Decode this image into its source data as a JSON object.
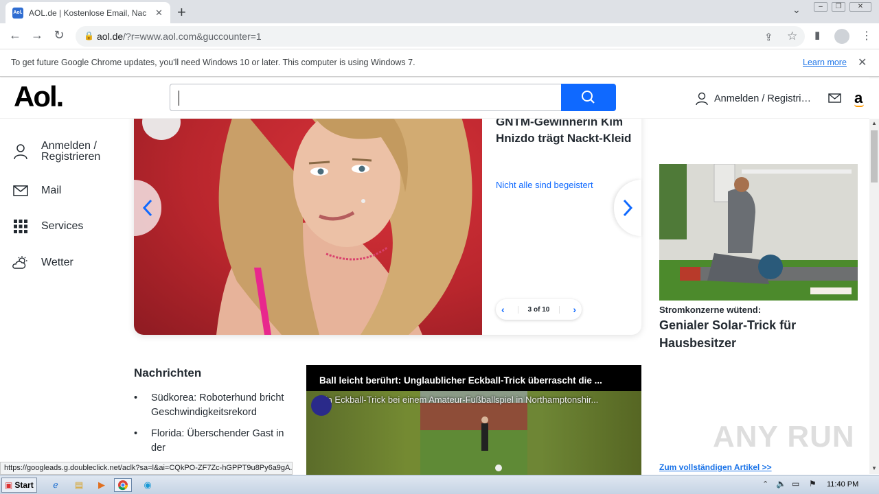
{
  "browser": {
    "tab_title": "AOL.de | Kostenlose Email, Nachrichten",
    "tab_favicon_text": "Aol.",
    "url_host": "aol.de",
    "url_path": "/?r=www.aol.com&guccounter=1",
    "new_tab_symbol": "+"
  },
  "infobar": {
    "message": "To get future Google Chrome updates, you'll need Windows 10 or later. This computer is using Windows 7.",
    "learn_more": "Learn more"
  },
  "header": {
    "logo": "Aol.",
    "search_placeholder": "",
    "login": "Anmelden / Registri…",
    "amazon": "a"
  },
  "sidebar": {
    "items": [
      {
        "label": "Anmelden / Registrieren",
        "icon": "user-icon"
      },
      {
        "label": "Mail",
        "icon": "mail-icon"
      },
      {
        "label": "Services",
        "icon": "grid-icon"
      },
      {
        "label": "Wetter",
        "icon": "weather-icon"
      }
    ]
  },
  "carousel": {
    "headline": "GNTM-Gewinnerin Kim Hnizdo trägt Nackt-Kleid",
    "subline": "Nicht alle sind begeistert",
    "pager": "3 of 10"
  },
  "ad": {
    "kicker": "Stromkonzerne wütend:",
    "title": "Genialer Solar-Trick für Hausbesitzer",
    "link": "Zum vollständigen Artikel >>"
  },
  "news": {
    "heading": "Nachrichten",
    "items": [
      "Südkorea: Roboterhund bricht Geschwindigkeitsrekord",
      "Florida: Überschender Gast in der"
    ]
  },
  "video": {
    "title": "Ball leicht berührt: Unglaublicher Eckball-Trick überrascht die ...",
    "description": "Ein Eckball-Trick bei einem Amateur-Fußballspiel in Northamptonshir..."
  },
  "status_url": "https://googleads.g.doubleclick.net/aclk?sa=l&ai=CQkPO-ZF7Zc-hGPPT9u8Py6a9gA...",
  "watermark": "ANY RUN",
  "taskbar": {
    "start": "Start",
    "clock": "11:40 PM"
  },
  "colors": {
    "aol_blue": "#0f69ff",
    "chrome_tabstrip": "#dee1e6"
  }
}
